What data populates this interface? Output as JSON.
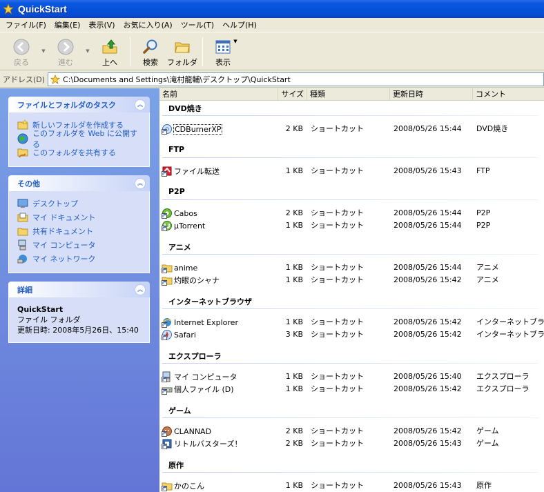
{
  "window": {
    "title": "QuickStart",
    "title_icon": "star-icon"
  },
  "menu": [
    "ファイル(F)",
    "編集(E)",
    "表示(V)",
    "お気に入り(A)",
    "ツール(T)",
    "ヘルプ(H)"
  ],
  "toolbar": {
    "back": "戻る",
    "forward": "進む",
    "up": "上へ",
    "search": "検索",
    "folders": "フォルダ",
    "views": "表示"
  },
  "address": {
    "label": "アドレス(D)",
    "path": "C:\\Documents and Settings\\滝村龍輔\\デスクトップ\\QuickStart"
  },
  "tasks": {
    "title": "ファイルとフォルダのタスク",
    "items": [
      "新しいフォルダを作成する",
      "このフォルダを Web に公開する",
      "このフォルダを共有する"
    ]
  },
  "others": {
    "title": "その他",
    "items": [
      "デスクトップ",
      "マイ ドキュメント",
      "共有ドキュメント",
      "マイ コンピュータ",
      "マイ ネットワーク"
    ]
  },
  "details": {
    "title": "詳細",
    "name": "QuickStart",
    "type": "ファイル フォルダ",
    "modified": "更新日時: 2008年5月26日、15:40"
  },
  "columns": {
    "name": "名前",
    "size": "サイズ",
    "type": "種類",
    "date": "更新日時",
    "comment": "コメント"
  },
  "groups": [
    {
      "title": "DVD焼き",
      "items": [
        {
          "name": "CDBurnerXP",
          "size": "2 KB",
          "type": "ショートカット",
          "date": "2008/05/26 15:44",
          "comment": "DVD焼き",
          "icon": "cdburner-icon"
        }
      ]
    },
    {
      "title": "FTP",
      "items": [
        {
          "name": "ファイル転送",
          "size": "1 KB",
          "type": "ショートカット",
          "date": "2008/05/26 15:43",
          "comment": "FTP",
          "icon": "ftp-icon"
        }
      ]
    },
    {
      "title": "P2P",
      "items": [
        {
          "name": "Cabos",
          "size": "2 KB",
          "type": "ショートカット",
          "date": "2008/05/26 15:44",
          "comment": "P2P",
          "icon": "cabos-icon"
        },
        {
          "name": "µTorrent",
          "size": "1 KB",
          "type": "ショートカット",
          "date": "2008/05/26 15:44",
          "comment": "P2P",
          "icon": "utorrent-icon"
        }
      ]
    },
    {
      "title": "アニメ",
      "items": [
        {
          "name": "anime",
          "size": "1 KB",
          "type": "ショートカット",
          "date": "2008/05/26 15:44",
          "comment": "アニメ",
          "icon": "folder-shortcut-icon"
        },
        {
          "name": "灼眼のシャナ",
          "size": "1 KB",
          "type": "ショートカット",
          "date": "2008/05/26 15:42",
          "comment": "アニメ",
          "icon": "folder-shortcut-icon"
        }
      ]
    },
    {
      "title": "インターネットブラウザ",
      "items": [
        {
          "name": "Internet Explorer",
          "size": "1 KB",
          "type": "ショートカット",
          "date": "2008/05/26 15:42",
          "comment": "インターネットブラウザ",
          "icon": "ie-icon"
        },
        {
          "name": "Safari",
          "size": "3 KB",
          "type": "ショートカット",
          "date": "2008/05/26 15:42",
          "comment": "インターネットブラウザ",
          "icon": "safari-icon"
        }
      ]
    },
    {
      "title": "エクスプローラ",
      "items": [
        {
          "name": "マイ コンピュータ",
          "size": "1 KB",
          "type": "ショートカット",
          "date": "2008/05/26 15:40",
          "comment": "エクスプローラ",
          "icon": "computer-icon"
        },
        {
          "name": "個人ファイル (D)",
          "size": "1 KB",
          "type": "ショートカット",
          "date": "2008/05/26 15:42",
          "comment": "エクスプローラ",
          "icon": "drive-icon"
        }
      ]
    },
    {
      "title": "ゲーム",
      "items": [
        {
          "name": "CLANNAD",
          "size": "2 KB",
          "type": "ショートカット",
          "date": "2008/05/26 15:42",
          "comment": "ゲーム",
          "icon": "clannad-icon"
        },
        {
          "name": "リトルバスターズ！",
          "size": "2 KB",
          "type": "ショートカット",
          "date": "2008/05/26 15:43",
          "comment": "ゲーム",
          "icon": "game-icon"
        }
      ]
    },
    {
      "title": "原作",
      "items": [
        {
          "name": "かのこん",
          "size": "1 KB",
          "type": "ショートカット",
          "date": "2008/05/26 15:43",
          "comment": "原作",
          "icon": "folder-shortcut-icon"
        }
      ]
    }
  ]
}
